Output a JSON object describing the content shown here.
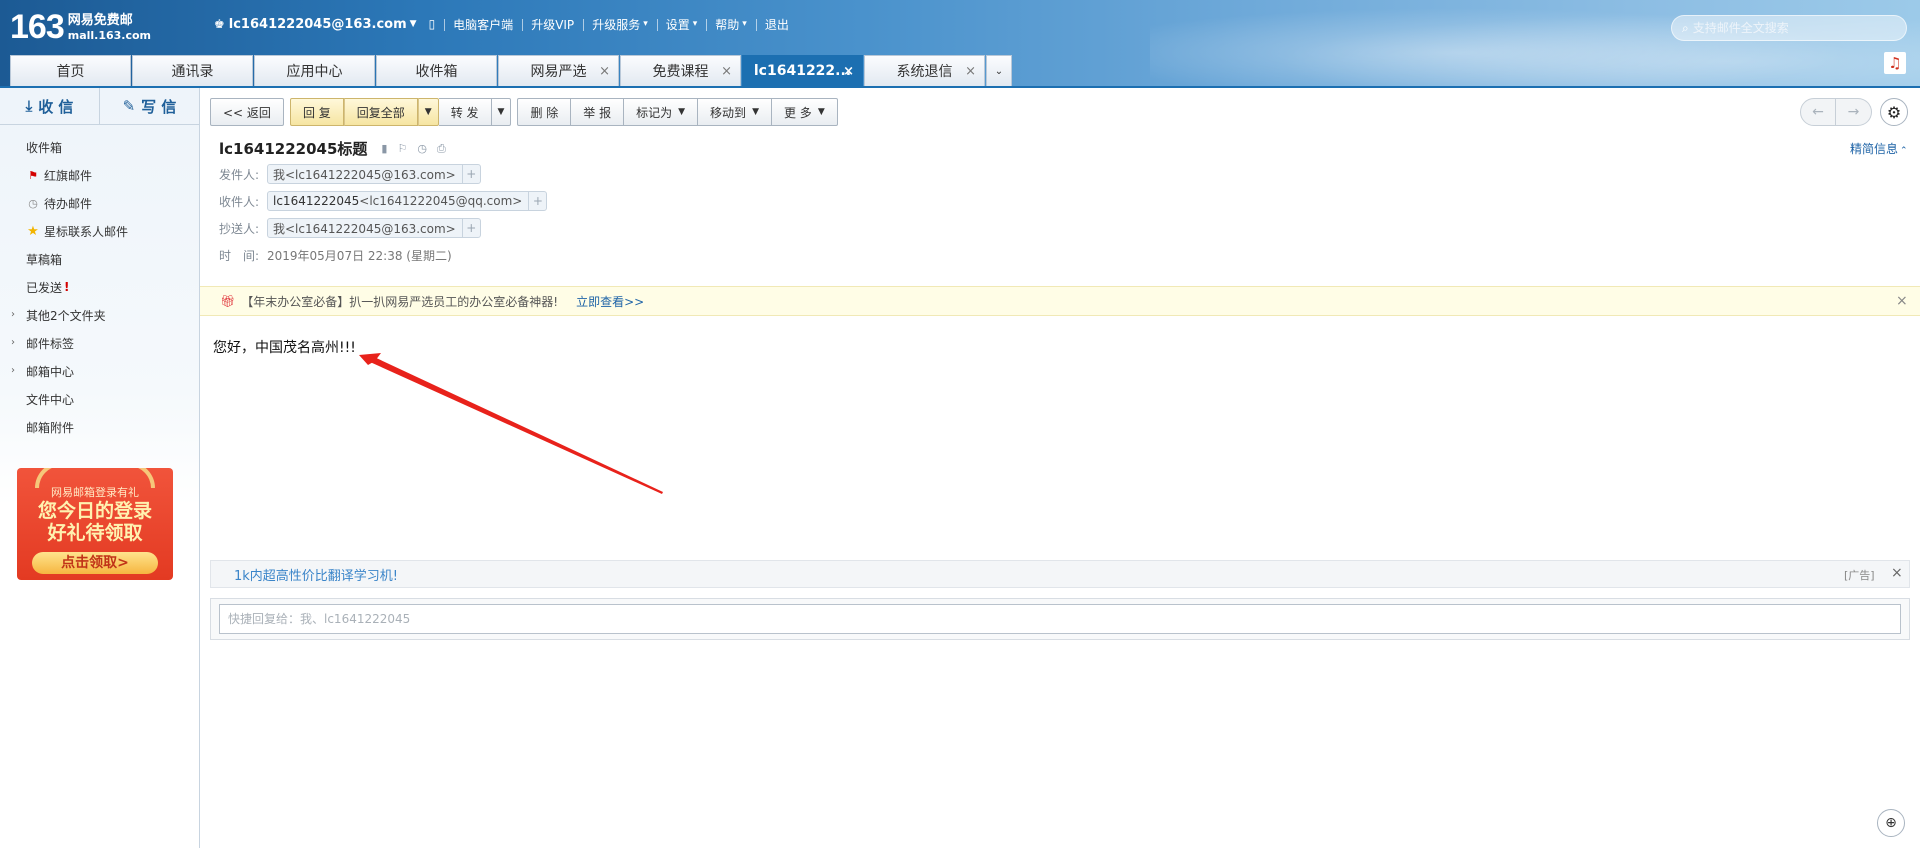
{
  "header": {
    "logo_number": "163",
    "logo_line1": "网易免费邮",
    "logo_line2": "mall.163.com",
    "user": "lc1641222045@163.com",
    "nav": [
      "电脑客户端",
      "升级VIP",
      "升级服务",
      "设置",
      "帮助",
      "退出"
    ],
    "search_placeholder": "支持邮件全文搜索"
  },
  "tabs": [
    {
      "label": "首页",
      "closable": false,
      "active": false
    },
    {
      "label": "通讯录",
      "closable": false,
      "active": false
    },
    {
      "label": "应用中心",
      "closable": false,
      "active": false
    },
    {
      "label": "收件箱",
      "closable": false,
      "active": false
    },
    {
      "label": "网易严选",
      "closable": true,
      "active": false
    },
    {
      "label": "免费课程",
      "closable": true,
      "active": false
    },
    {
      "label": "lc1641222...",
      "closable": true,
      "active": true
    },
    {
      "label": "系统退信",
      "closable": true,
      "active": false
    }
  ],
  "sidebar": {
    "receive": "收 信",
    "compose": "写 信",
    "folders": [
      {
        "label": "收件箱"
      },
      {
        "label": "红旗邮件"
      },
      {
        "label": "待办邮件"
      },
      {
        "label": "星标联系人邮件"
      },
      {
        "label": "草稿箱"
      },
      {
        "label": "已发送",
        "mark": "!"
      },
      {
        "label": "其他2个文件夹"
      },
      {
        "label": "邮件标签"
      },
      {
        "label": "邮箱中心"
      },
      {
        "label": "文件中心"
      },
      {
        "label": "邮箱附件"
      }
    ],
    "promo": {
      "line1": "网易邮箱登录有礼",
      "line2": "您今日的登录",
      "line3": "好礼待领取",
      "cta": "点击领取>"
    }
  },
  "toolbar": {
    "back": "<< 返回",
    "reply": "回 复",
    "reply_all": "回复全部",
    "forward": "转 发",
    "delete": "删 除",
    "report": "举 报",
    "mark_as": "标记为",
    "move_to": "移动到",
    "more": "更 多"
  },
  "mail": {
    "subject": "lc1641222045标题",
    "detail_toggle": "精简信息",
    "from_label": "发件人:",
    "from": "我<lc1641222045@163.com>",
    "to_label": "收件人:",
    "to_name": "lc1641222045",
    "to_addr": "<lc1641222045@qq.com>",
    "cc_label": "抄送人:",
    "cc": "我<lc1641222045@163.com>",
    "time_label": "时　间:",
    "time": "2019年05月07日 22:38 (星期二)",
    "body": "您好，中国茂名高州!!!"
  },
  "notice": {
    "text": "【年末办公室必备】扒一扒网易严选员工的办公室必备神器!",
    "link": "立即查看>>"
  },
  "ad": {
    "text": "1k内超高性价比翻译学习机!",
    "tag": "[广告]"
  },
  "reply_box": {
    "placeholder": "快捷回复给：我、lc1641222045"
  },
  "colors": {
    "brand_blue": "#1c6fb1",
    "annotation_arrow": "#e8221b"
  }
}
